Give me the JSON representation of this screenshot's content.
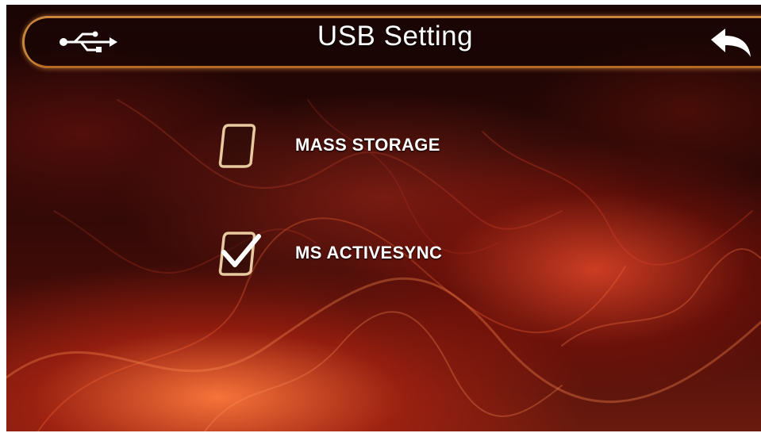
{
  "header": {
    "title": "USB Setting",
    "left_icon": "usb-icon",
    "right_icon": "back-arrow-icon"
  },
  "options": [
    {
      "label": "MASS STORAGE",
      "checked": false,
      "icon": "checkbox-icon"
    },
    {
      "label": "MS ACTIVESYNC",
      "checked": true,
      "icon": "checkbox-checked-icon"
    }
  ],
  "colors": {
    "frame_gold": "#c9863a",
    "text": "#ffffff",
    "background_dark": "#1a0504",
    "background_flame": "#e84a28"
  }
}
